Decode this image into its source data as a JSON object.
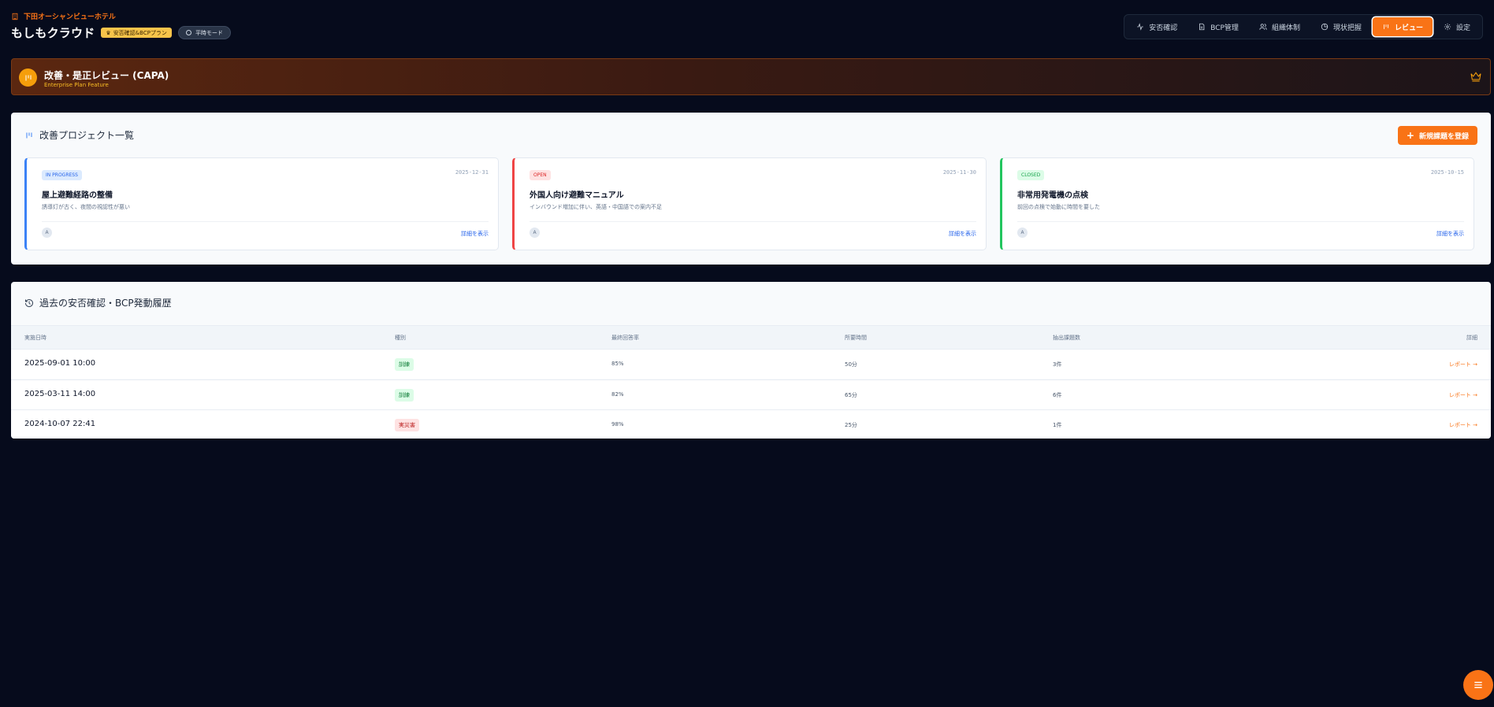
{
  "header": {
    "hotel_name": "下田オーシャンビューホテル",
    "brand": "もしもクラウド",
    "plan_badge": "安否確認&BCPプラン",
    "mode_label": "平時モード"
  },
  "nav": {
    "items": [
      {
        "label": "安否確認",
        "icon": "activity-icon"
      },
      {
        "label": "BCP管理",
        "icon": "document-icon"
      },
      {
        "label": "組織体制",
        "icon": "users-icon"
      },
      {
        "label": "現状把握",
        "icon": "pie-chart-icon"
      },
      {
        "label": "レビュー",
        "icon": "kanban-icon",
        "active": true
      },
      {
        "label": "設定",
        "icon": "gear-icon"
      }
    ]
  },
  "banner": {
    "title": "改善・是正レビュー (CAPA)",
    "subtitle": "Enterprise Plan Feature"
  },
  "projects": {
    "title": "改善プロジェクト一覧",
    "new_button": "新規課題を登録",
    "cards": [
      {
        "status": "IN PROGRESS",
        "date": "2025-12-31",
        "title": "屋上避難経路の整備",
        "desc": "誘導灯が古く、夜間の視認性が悪い",
        "assignee": "A",
        "link": "詳細を表示",
        "accent": "#3b82f6",
        "status_bg": "#dbeafe",
        "status_fg": "#2563eb"
      },
      {
        "status": "OPEN",
        "date": "2025-11-30",
        "title": "外国人向け避難マニュアル",
        "desc": "インバウンド増加に伴い、英語・中国語での案内不足",
        "assignee": "A",
        "link": "詳細を表示",
        "accent": "#ef4444",
        "status_bg": "#fee2e2",
        "status_fg": "#dc2626"
      },
      {
        "status": "CLOSED",
        "date": "2025-10-15",
        "title": "非常用発電機の点検",
        "desc": "前回の点検で始動に時間を要した",
        "assignee": "A",
        "link": "詳細を表示",
        "accent": "#22c55e",
        "status_bg": "#dcfce7",
        "status_fg": "#16a34a"
      }
    ]
  },
  "history": {
    "title": "過去の安否確認・BCP発動履歴",
    "columns": [
      "実施日時",
      "種別",
      "最終回答率",
      "所要時間",
      "抽出課題数",
      "詳細"
    ],
    "rows": [
      {
        "datetime": "2025-09-01 10:00",
        "type": "訓練",
        "type_kind": "train",
        "rate": "85%",
        "duration": "50分",
        "issues": "3件",
        "report": "レポート →"
      },
      {
        "datetime": "2025-03-11 14:00",
        "type": "訓練",
        "type_kind": "train",
        "rate": "82%",
        "duration": "65分",
        "issues": "6件",
        "report": "レポート →"
      },
      {
        "datetime": "2024-10-07 22:41",
        "type": "実災害",
        "type_kind": "real",
        "rate": "98%",
        "duration": "25分",
        "issues": "1件",
        "report": "レポート →"
      }
    ]
  },
  "colors": {
    "accent": "#f97316",
    "background": "#060b1c"
  }
}
